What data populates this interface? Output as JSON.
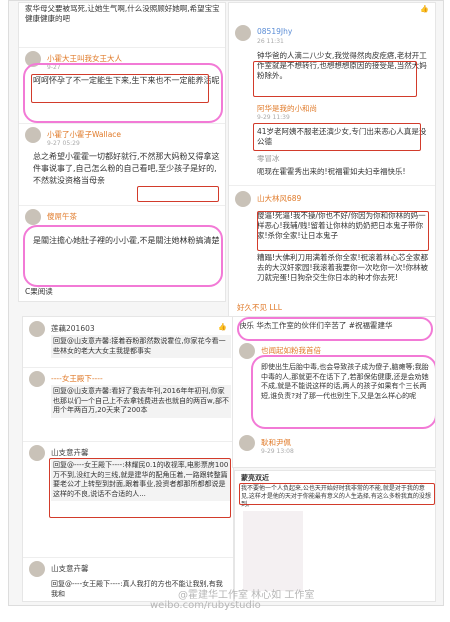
{
  "tl": {
    "intro": "家华母父要被骂死,让她生气啊,什么没照顾好她啊,希望宝宝健康健康的吧",
    "c1": {
      "user": "小霍大王叫我女王大人",
      "date": "9-27",
      "text": "呵呵怀孕了不一定能生下来,生下来也不一定能养活呢"
    },
    "c2": {
      "user": "小霍了小霍子Wallace",
      "date": "9-27 05:29",
      "text": "总之希望小霍霍一切都好就行,不然那大妈粉又得拿这件事说事了,自己怎么粉的自己看吧,至少孩子是好的,不然就没资格当母亲"
    },
    "c3": {
      "user": "傻屌午茶",
      "text": "是關注擔心她肚子裡的小小霍,不是關注她林粉搞清楚"
    },
    "c4": {
      "text": "C果阅读"
    }
  },
  "tr": {
    "c1": {
      "user": "08519Jhy",
      "date": "26 11:31",
      "text": "钟华爸的人滴二八少女,我觉得然肉皮疙瘩,老材开工作室就是不想转行,也想想想原因的接受是,当然大妈粉除外。"
    },
    "c2": {
      "user": "阿华是我的小和尚",
      "date": "9-29 11:39",
      "text": "41岁老阿姨不服老还演少女,专门出来恶心人真是没公德"
    },
    "c3": {
      "user": "零冒冰",
      "text": "呃现在霍霍秀出来的!祝福霍如夫妇幸福快乐!"
    },
    "c4": {
      "user": "山大林风689",
      "text": "傻逼!死逼!我不操/你也不好/你因为你和你林的妈一样恶心!我辅/贱!留着让你林的奶奶把日本鬼子带你家!杀你全家!让日本鬼子",
      "more": "糟蹋!大佛利刀用满着杀你全家!祝滚着林心芯全家都去的大汉奸家园!我滚着我要你一次吃你一次!你林被刀就完蛋!日狗杂交生你日本的种才你去死!"
    },
    "c5": {
      "user": "好久不见 LLL"
    }
  },
  "bl": {
    "c1": {
      "user": "莲藕201603",
      "text": "回复@山支意卉馨:接着吞粉那然数说霍位,你家花今看一些林女的老大大女主我提都事实"
    },
    "c2": {
      "user": "----女王殿下----",
      "text": "回复@山支意卉馨:看好了我去年刊,2016年年初刊,你家也那以们一个自己上不去拿钱费进去也就自的两百w,部不用个年两百万,20天来了200本"
    },
    "c3": {
      "user": "山支意卉馨",
      "text": "回复@----女王殿下----:林耀民0.1的收视率,电影票房100万不到,没红大的三线,就是建华的配角压着,一路跟转整篇要老公才上转型到封面,跟着事业,投资者都那所都都说是这样的不良,说话不合适的人..."
    },
    "c4": {
      "user": "山支意卉馨",
      "text": "回复@----女王殿下----:真人我打的方也不能让我别,有我我和"
    }
  },
  "br": {
    "c1": {
      "text": "快乐 华杰工作室的伙伴们辛苦了 #祝福霍建华"
    },
    "c2": {
      "user": "也闻起如粉我首倍",
      "text": "即使出生后胎中毒,也会导致孩子成为傻子,脑瘫等;我胎中毒的人,那就更不在话下了,若那保佑健康,还是会劝她不成,就是不能说这样的话,两人的孩子如果有个三长两短,谁负责?对了那一代也别生下,又是怎么样心的呢"
    },
    "c3": {
      "user": "耿和尹佩",
      "date": "9-29 13:08"
    }
  },
  "article": {
    "title": "蒙亮双近",
    "body": "我不要他一个人负起来,公也天开始好时我非常的不能,就是对于我的意见,这样才是他的天对于你能最有意义的人生选择,有这么多粉我真的没想到。"
  },
  "watermark": {
    "line1": "@霍建华工作室 林心如 工作室",
    "line2": "weibo.com/rubystudio"
  }
}
